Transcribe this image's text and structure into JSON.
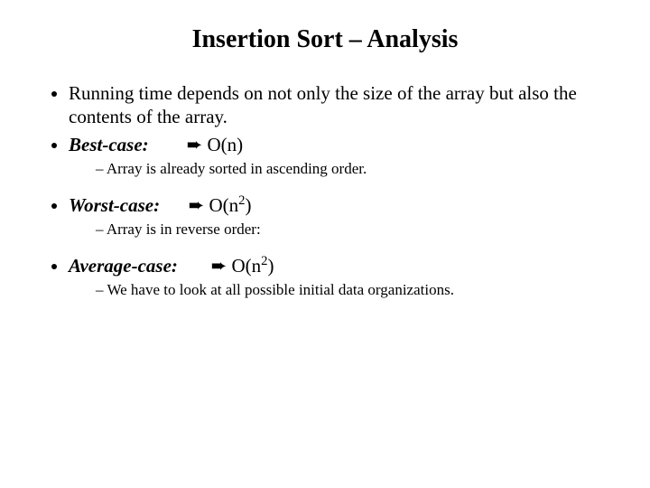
{
  "title": "Insertion Sort – Analysis",
  "b1": "Running time depends on not only the size of the array but also the contents of the array.",
  "best": {
    "label": "Best-case:",
    "arrow": "➨",
    "complexity": "O(n)",
    "sub": "Array is already sorted in ascending order."
  },
  "worst": {
    "label": "Worst-case:",
    "arrow": "➨",
    "o": "O(n",
    "exp": "2",
    "close": ")",
    "sub": "Array is in reverse order:"
  },
  "avg": {
    "label": "Average-case:",
    "arrow": "➨",
    "o": "O(n",
    "exp": "2",
    "close": ")",
    "sub": "We have to look at all possible initial data organizations."
  }
}
